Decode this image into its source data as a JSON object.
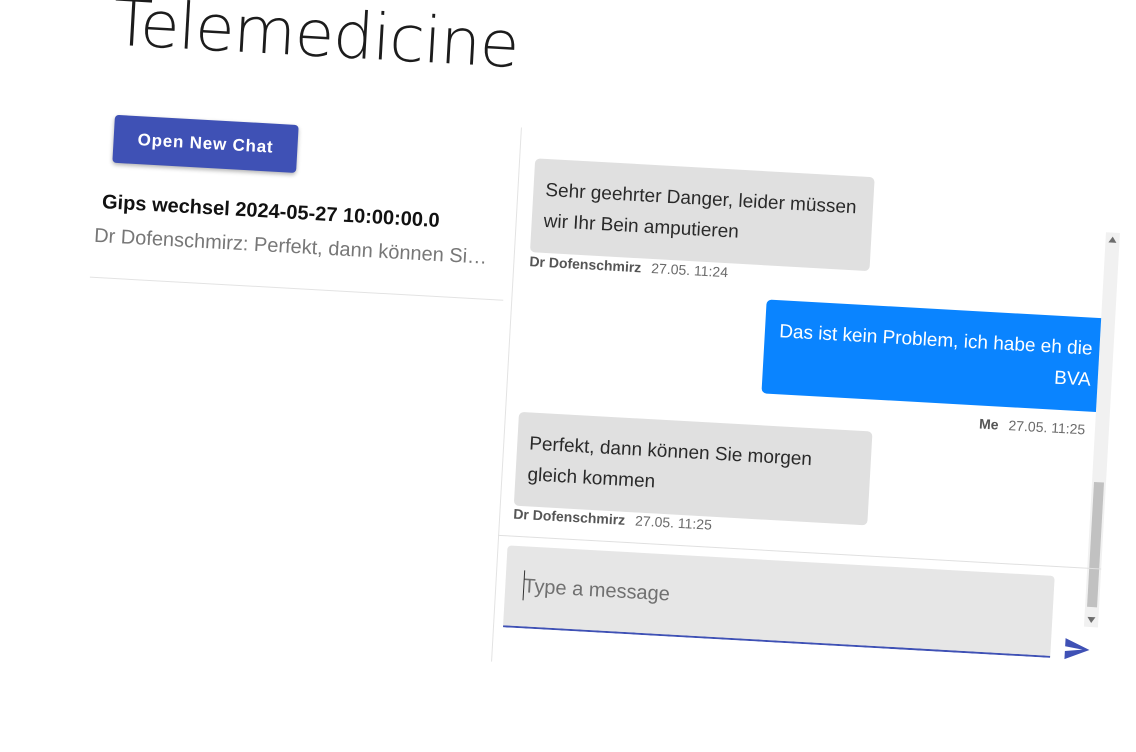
{
  "app": {
    "title": "Telemedicine"
  },
  "sidebar": {
    "open_chat_label": "Open New Chat",
    "chats": [
      {
        "title": "Gips wechsel 2024-05-27 10:00:00.0",
        "preview": "Dr Dofenschmirz: Perfekt, dann können Sie morgen gleich kommen"
      }
    ]
  },
  "messages": [
    {
      "text": "Sehr geehrter Danger, leider müssen wir Ihr Bein amputieren",
      "sender": "Dr Dofenschmirz",
      "time": "27.05. 11:24",
      "direction": "received"
    },
    {
      "text": "Das ist kein Problem, ich habe eh die BVA",
      "sender": "Me",
      "time": "27.05. 11:25",
      "direction": "sent"
    },
    {
      "text": "Perfekt, dann können Sie morgen gleich kommen",
      "sender": "Dr Dofenschmirz",
      "time": "27.05. 11:25",
      "direction": "received"
    }
  ],
  "composer": {
    "placeholder": "Type a message",
    "send_icon": "send-icon"
  },
  "colors": {
    "primary": "#3f51b5",
    "sent_bubble": "#0a84ff",
    "received_bubble": "#e0e0e0"
  }
}
